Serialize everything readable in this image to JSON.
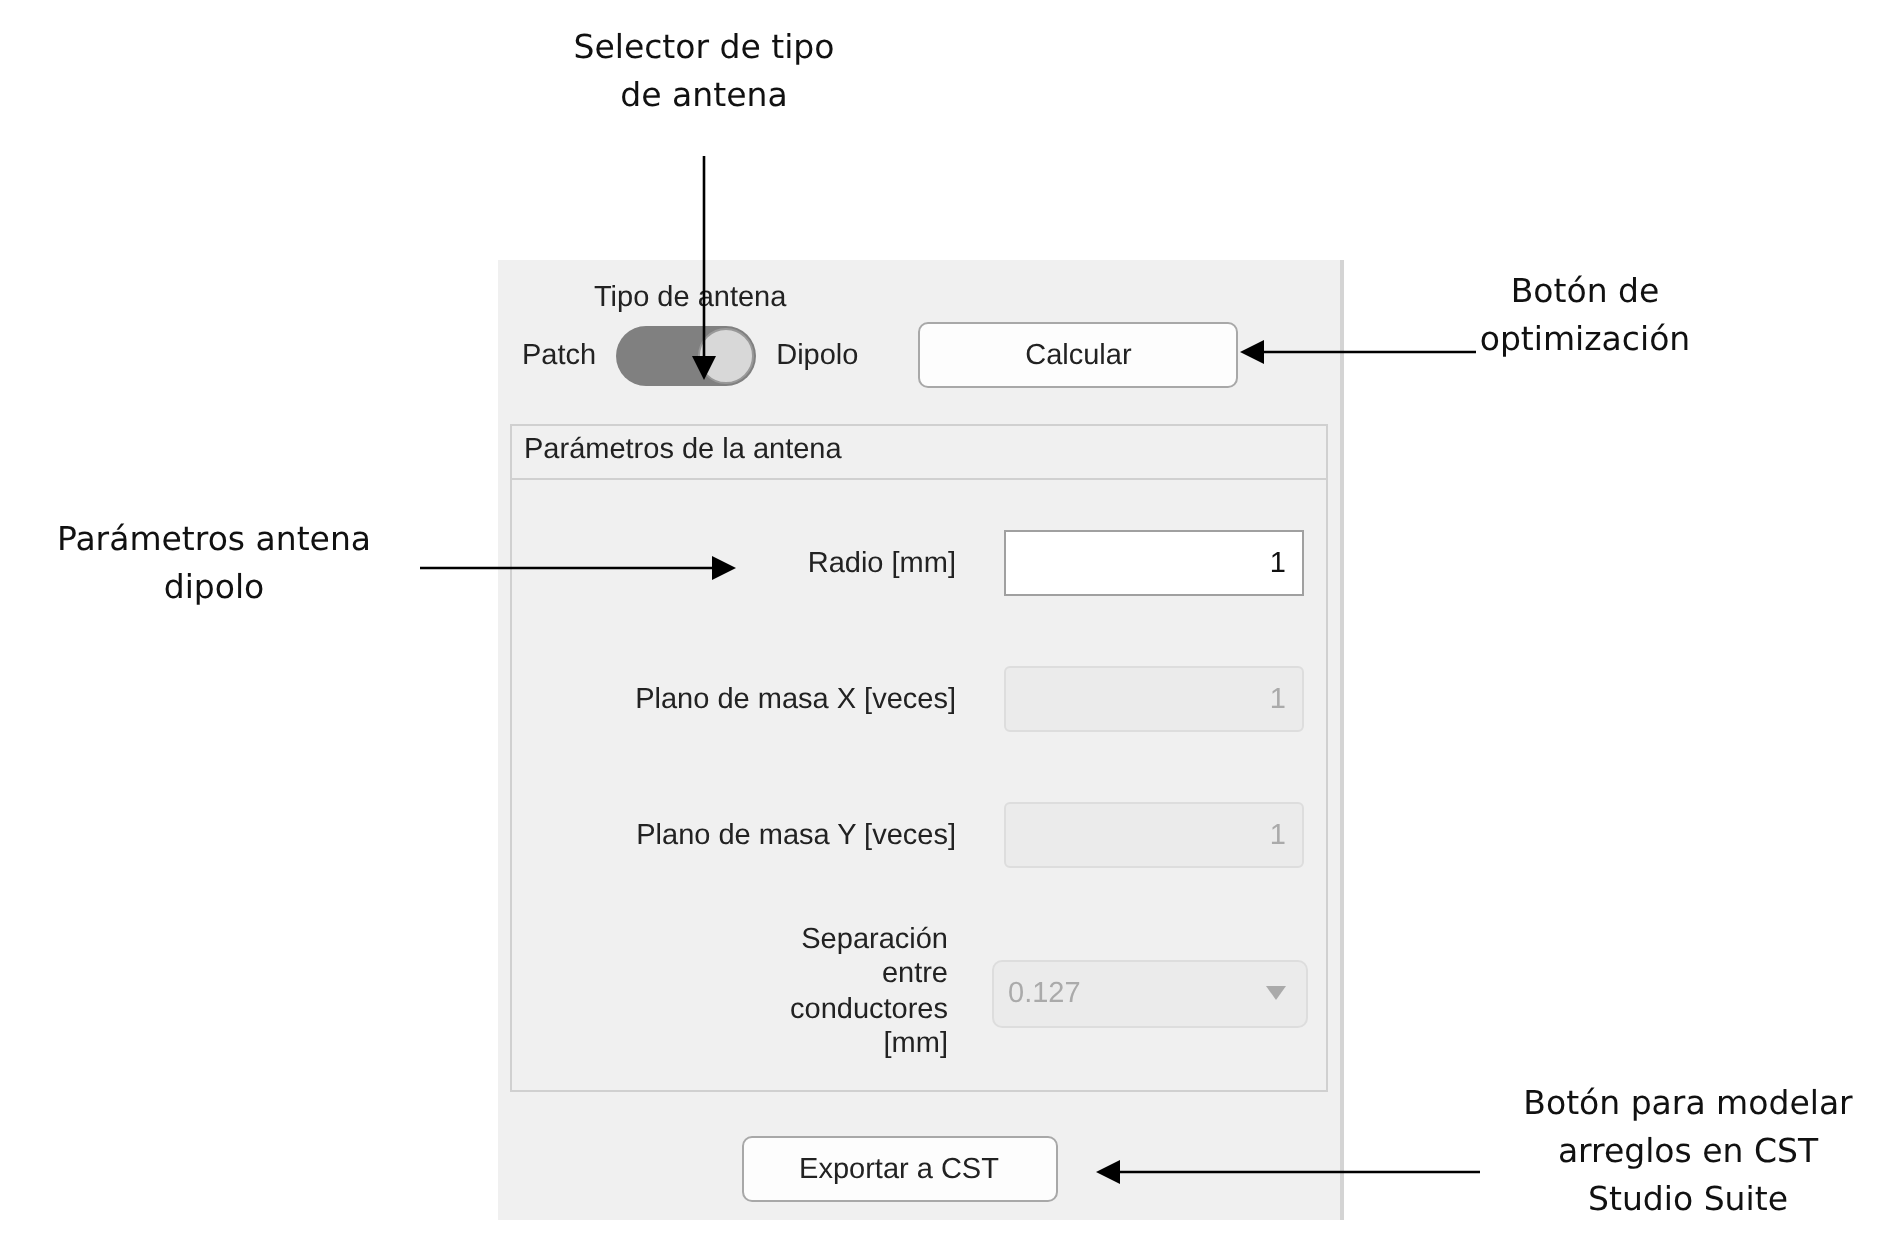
{
  "panel": {
    "antenna_type": {
      "label": "Tipo de antena",
      "off_label": "Patch",
      "on_label": "Dipolo",
      "on": true
    },
    "calculate_button": "Calcular",
    "parameters": {
      "title": "Parámetros de la antena",
      "rows": [
        {
          "kind": "numeric",
          "label": "Radio [mm]",
          "value": "1",
          "disabled": false
        },
        {
          "kind": "numeric",
          "label": "Plano de masa X [veces]",
          "value": "1",
          "disabled": true
        },
        {
          "kind": "numeric",
          "label": "Plano de masa Y [veces]",
          "value": "1",
          "disabled": true
        },
        {
          "kind": "dropdown",
          "label": "Separación entre conductores [mm]",
          "value": "0.127",
          "disabled": true
        }
      ]
    },
    "export_button": "Exportar a CST"
  },
  "annotations": [
    {
      "text": "Selector de tipo de antena"
    },
    {
      "text": "Botón de optimización"
    },
    {
      "text": "Parámetros antena dipolo"
    },
    {
      "text": "Botón para modelar arreglos en CST Studio Suite"
    }
  ]
}
